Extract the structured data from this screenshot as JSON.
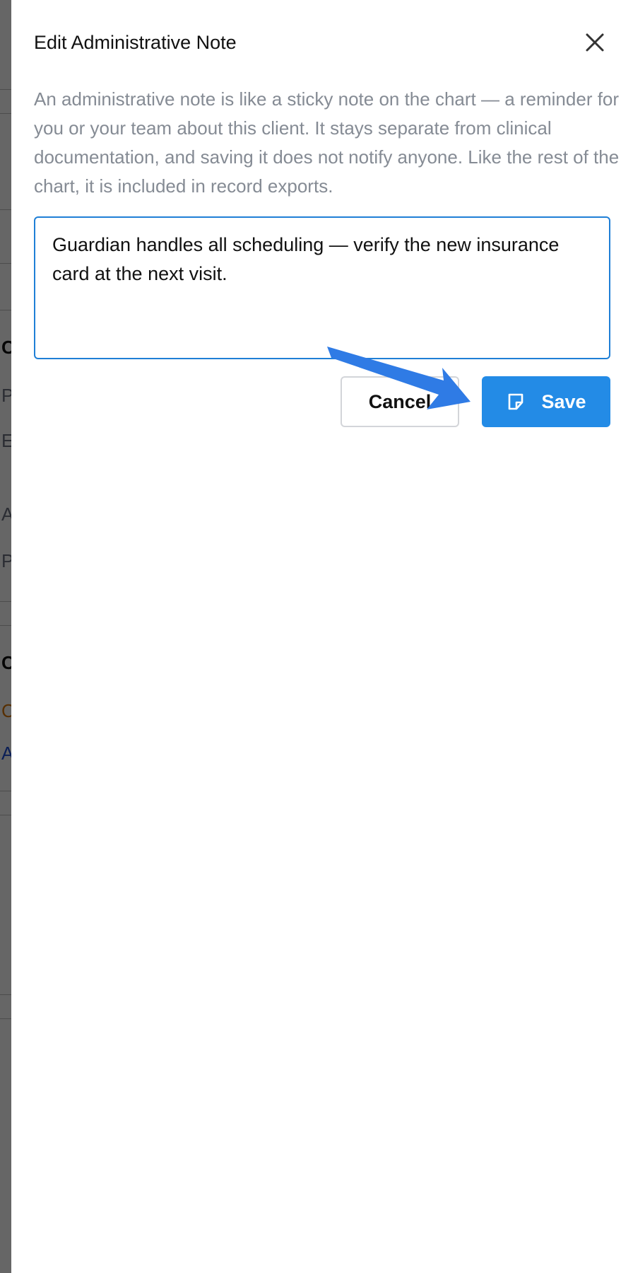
{
  "drawer": {
    "title": "Edit Administrative Note",
    "description": "An administrative note is like a sticky note on the chart — a reminder for you or your team about this client. It stays separate from clinical documentation, and saving it does not notify anyone. Like the rest of the chart, it is included in record exports.",
    "note_value": "Guardian handles all scheduling — verify the new insurance card at the next visit.",
    "cancel_label": "Cancel",
    "save_label": "Save"
  },
  "background_page": {
    "letters": [
      "C",
      "P",
      "E",
      "A",
      "P",
      "C",
      "C",
      "A"
    ]
  },
  "colors": {
    "accent": "#238be6",
    "focus_border": "#1f7fd6",
    "annotation_arrow": "#2f7be5",
    "muted_text": "#858b94"
  },
  "icons": {
    "close": "close-icon",
    "save": "sticky-note-icon"
  }
}
